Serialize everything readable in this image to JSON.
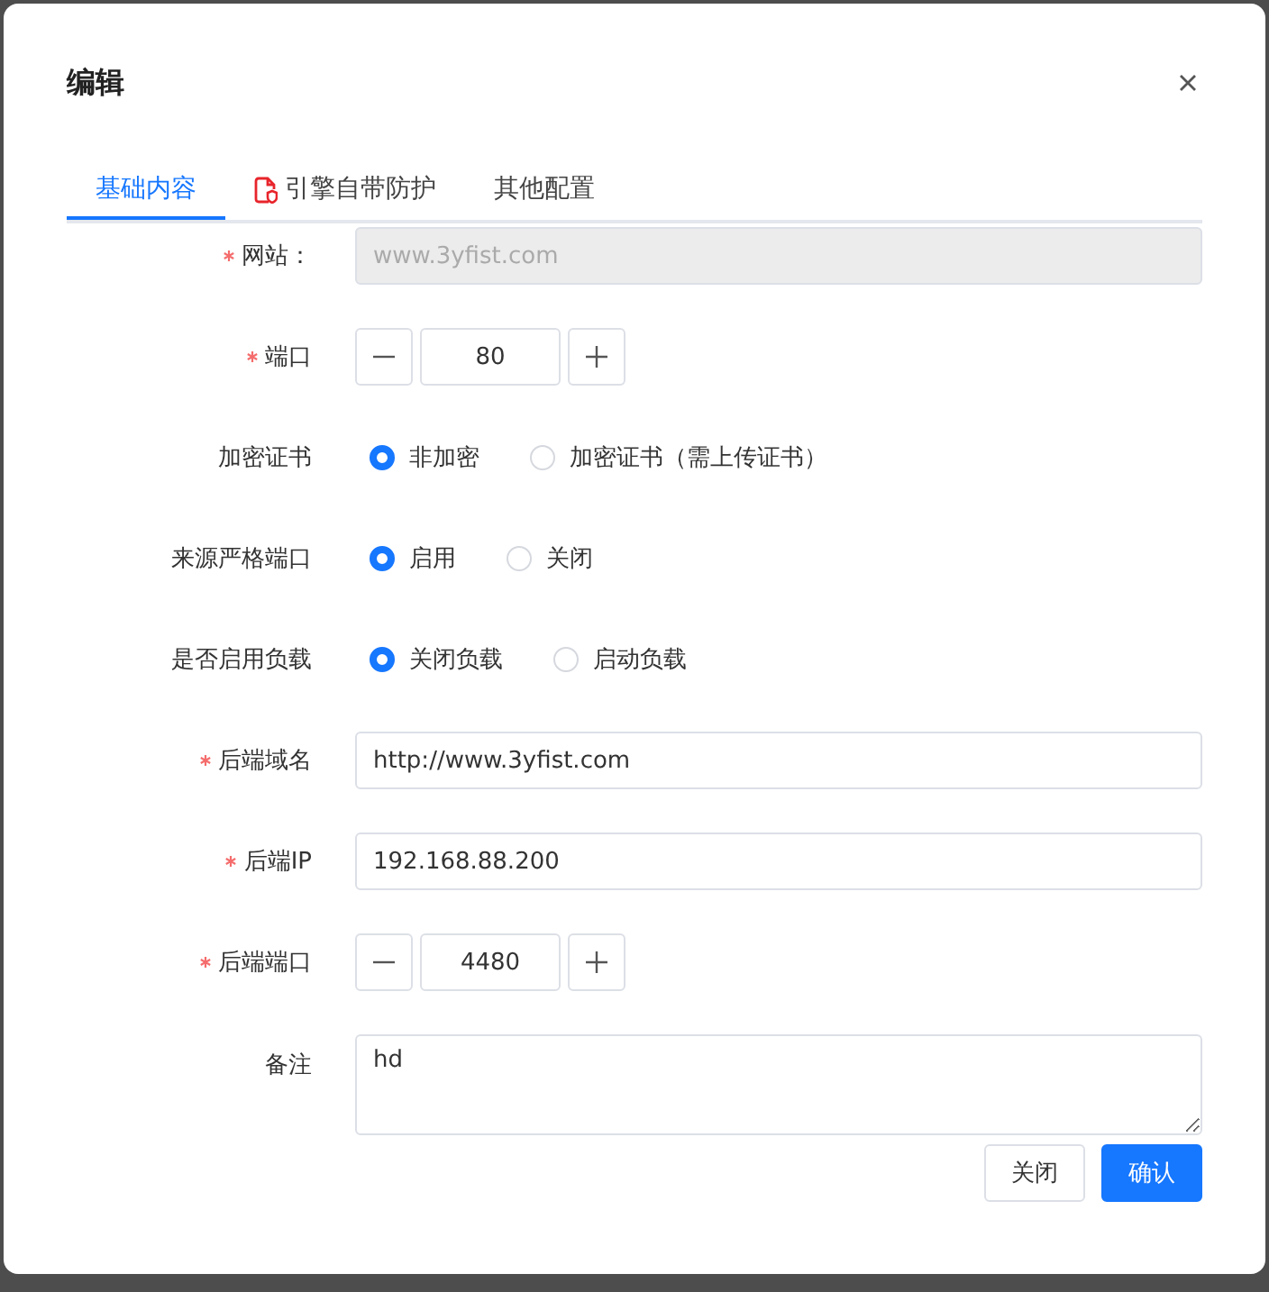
{
  "dialog": {
    "title": "编辑"
  },
  "tabs": [
    {
      "label": "基础内容",
      "selected": true,
      "has_icon": false
    },
    {
      "label": "引擎自带防护",
      "selected": false,
      "has_icon": true
    },
    {
      "label": "其他配置",
      "selected": false,
      "has_icon": false
    }
  ],
  "fields": [
    {
      "kind": "text",
      "label": "网站：",
      "required": true,
      "disabled": true,
      "value": "www.3yfist.com"
    },
    {
      "kind": "number",
      "label": "端口",
      "required": true,
      "value": "80"
    },
    {
      "kind": "radio",
      "label": "加密证书",
      "required": false,
      "options": [
        {
          "label": "非加密",
          "selected": true
        },
        {
          "label": "加密证书（需上传证书）",
          "selected": false
        }
      ]
    },
    {
      "kind": "radio",
      "label": "来源严格端口",
      "required": false,
      "options": [
        {
          "label": "启用",
          "selected": true
        },
        {
          "label": "关闭",
          "selected": false
        }
      ]
    },
    {
      "kind": "radio",
      "label": "是否启用负载",
      "required": false,
      "options": [
        {
          "label": "关闭负载",
          "selected": true
        },
        {
          "label": "启动负载",
          "selected": false
        }
      ]
    },
    {
      "kind": "text",
      "label": "后端域名",
      "required": true,
      "disabled": false,
      "value": "http://www.3yfist.com"
    },
    {
      "kind": "text",
      "label": "后端IP",
      "required": true,
      "disabled": false,
      "value": "192.168.88.200"
    },
    {
      "kind": "number",
      "label": "后端端口",
      "required": true,
      "value": "4480"
    },
    {
      "kind": "textarea",
      "label": "备注",
      "required": false,
      "value": "hd"
    }
  ],
  "buttons": [
    {
      "label": "关闭",
      "kind": "default"
    },
    {
      "label": "确认",
      "kind": "primary"
    }
  ]
}
